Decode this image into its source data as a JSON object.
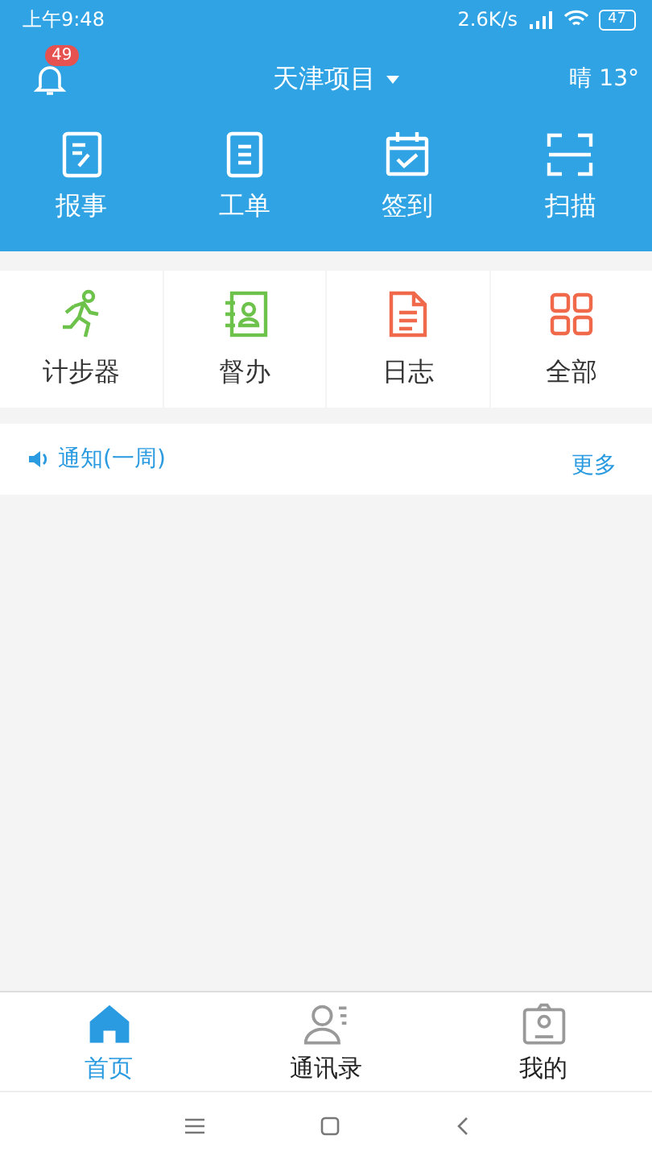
{
  "status_bar": {
    "time": "上午9:48",
    "speed": "2.6K/s",
    "battery": "47"
  },
  "header": {
    "badge": "49",
    "project": "天津项目",
    "weather": "晴 13°"
  },
  "quick_actions": [
    {
      "label": "报事",
      "kind": "report"
    },
    {
      "label": "工单",
      "kind": "order"
    },
    {
      "label": "签到",
      "kind": "checkin"
    },
    {
      "label": "扫描",
      "kind": "scan"
    }
  ],
  "modules": [
    {
      "label": "计步器",
      "kind": "runner",
      "color": "#6cc24a"
    },
    {
      "label": "督办",
      "kind": "contact",
      "color": "#6cc24a"
    },
    {
      "label": "日志",
      "kind": "doc",
      "color": "#f0694a"
    },
    {
      "label": "全部",
      "kind": "grid",
      "color": "#f0694a"
    }
  ],
  "notice": {
    "title": "通知(一周)",
    "more": "更多"
  },
  "tab_bar": [
    {
      "label": "首页",
      "kind": "home",
      "selected": true
    },
    {
      "label": "通讯录",
      "kind": "contacts",
      "selected": false
    },
    {
      "label": "我的",
      "kind": "me",
      "selected": false
    }
  ]
}
